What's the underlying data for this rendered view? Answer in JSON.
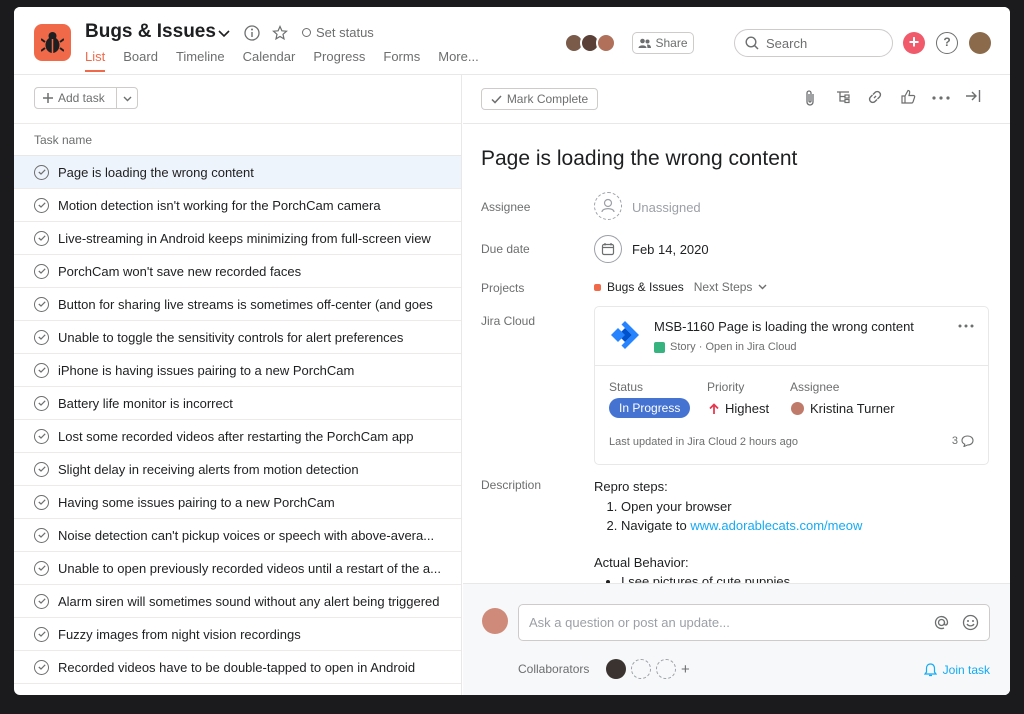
{
  "header": {
    "title": "Bugs & Issues",
    "set_status": "Set status",
    "tabs": [
      "List",
      "Board",
      "Timeline",
      "Calendar",
      "Progress",
      "Forms",
      "More..."
    ],
    "share_label": "Share",
    "search_placeholder": "Search",
    "plus_label": "+",
    "help_label": "?"
  },
  "list": {
    "add_task_label": "Add task",
    "column_header": "Task name",
    "tasks": [
      "Page is loading the wrong content",
      "Motion detection isn't working for the PorchCam camera",
      "Live-streaming in Android keeps minimizing from full-screen view",
      "PorchCam won't save new recorded faces",
      "Button for sharing live streams is sometimes off-center (and goes",
      "Unable to toggle the sensitivity controls for alert preferences",
      "iPhone is having issues pairing to a new PorchCam",
      "Battery life monitor is incorrect",
      "Lost some recorded videos after restarting the PorchCam app",
      "Slight delay in receiving alerts from motion detection",
      "Having some issues pairing to a new PorchCam",
      "Noise detection can't pickup voices or speech with above-avera...",
      "Unable to open previously recorded videos until a restart of the a...",
      "Alarm siren will sometimes sound without any alert being triggered",
      "Fuzzy images from night vision recordings",
      "Recorded videos have to be double-tapped to open in Android"
    ]
  },
  "detail": {
    "mark_complete": "Mark Complete",
    "title": "Page is loading the wrong content",
    "labels": {
      "assignee": "Assignee",
      "due_date": "Due date",
      "projects": "Projects",
      "jira": "Jira Cloud",
      "description": "Description"
    },
    "assignee_value": "Unassigned",
    "due_date_value": "Feb 14, 2020",
    "project_name": "Bugs & Issues",
    "project_section": "Next Steps",
    "jira_card": {
      "title": "MSB-1160 Page is loading the wrong content",
      "subtitle": "Story · Open in Jira Cloud",
      "status_label": "Status",
      "status_value": "In Progress",
      "priority_label": "Priority",
      "priority_value": "Highest",
      "assignee_label": "Assignee",
      "assignee_value": "Kristina Turner",
      "updated": "Last updated in Jira Cloud 2 hours ago",
      "comment_count": "3"
    },
    "description": {
      "repro_heading": "Repro steps:",
      "step1": "Open your browser",
      "step2_prefix": "Navigate to ",
      "step2_link": "www.adorablecats.com/meow",
      "actual_heading": "Actual Behavior:",
      "actual1": "I see pictures of cute puppies"
    }
  },
  "footer": {
    "comment_placeholder": "Ask a question or post an update...",
    "collaborators_label": "Collaborators",
    "add_collab": "+",
    "join_task": "Join task"
  },
  "colors": {
    "accent": "#f06a4a",
    "link": "#14aaf5",
    "status_pill": "#4573d2",
    "priority_arrow": "#e8384f"
  }
}
